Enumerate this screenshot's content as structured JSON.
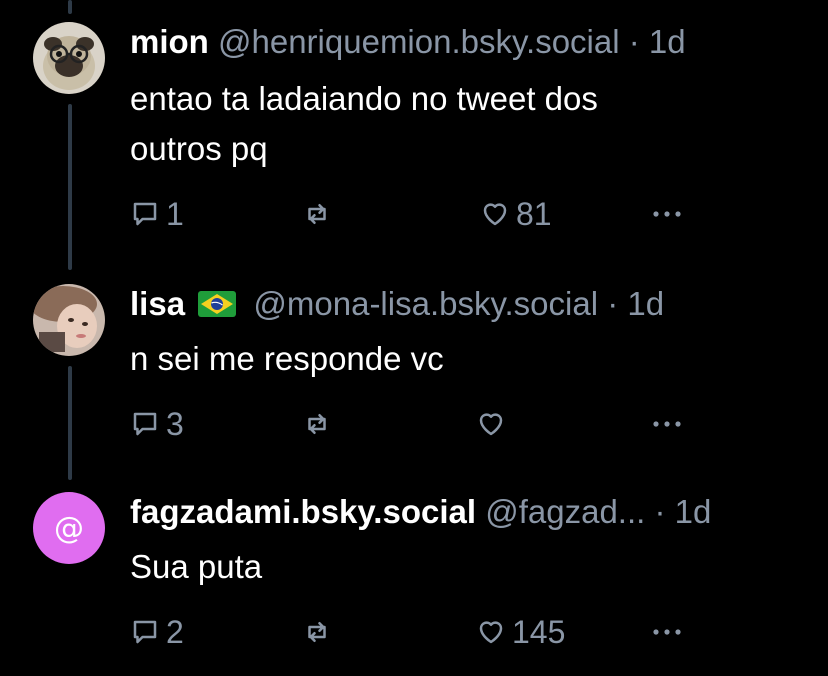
{
  "posts": [
    {
      "name": "mion",
      "handle": "@henriquemion.bsky.social",
      "sep": "·",
      "time": "1d",
      "text_lines": [
        "entao ta ladaiando no tweet dos",
        "outros pq"
      ],
      "reply_count": "1",
      "repost_count": "",
      "like_count": "81",
      "avatar": "pug-with-glasses"
    },
    {
      "name": "lisa",
      "flag": "brazil-flag-emoji",
      "handle": "@mona-lisa.bsky.social",
      "sep": "·",
      "time": "1d",
      "text_lines": [
        "n sei me responde vc"
      ],
      "reply_count": "3",
      "repost_count": "",
      "like_count": "",
      "avatar": "person-photo"
    },
    {
      "name": "fagzadami.bsky.social",
      "handle": "@fagzad...",
      "sep": "·",
      "time": "1d",
      "text_lines": [
        "Sua puta"
      ],
      "reply_count": "2",
      "repost_count": "",
      "like_count": "145",
      "avatar_glyph": "@",
      "avatar_color": "#e06df0"
    }
  ],
  "colors": {
    "background": "#000000",
    "muted": "#8a96a6",
    "thread_line": "#2e3a47"
  }
}
